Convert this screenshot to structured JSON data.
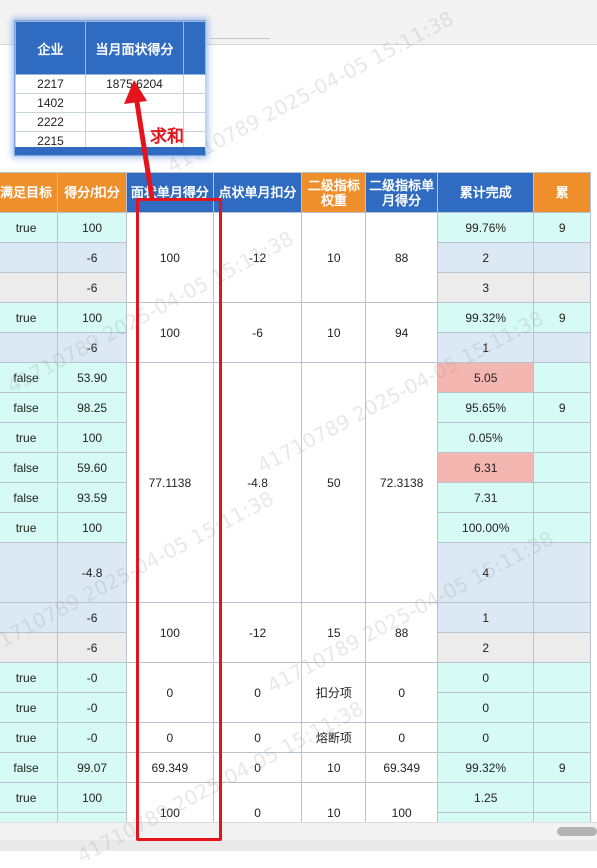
{
  "inset": {
    "headers": [
      "企业",
      "当月面状得分",
      ""
    ],
    "rows": [
      [
        "2217",
        "1875.6204",
        ""
      ],
      [
        "1402",
        "",
        ""
      ],
      [
        "2222",
        "",
        ""
      ],
      [
        "2215",
        "",
        ""
      ]
    ]
  },
  "annotation": {
    "label": "求和",
    "color": "#e5141c"
  },
  "watermark": "41710789 2025-04-05 15:11:38",
  "table": {
    "headers": {
      "c0": "满足目标",
      "c1": "得分/扣分",
      "c2": "面状单月得分",
      "c3": "点状单月扣分",
      "c4": "二级指标权重",
      "c5": "二级指标单月得分",
      "c6": "累计完成",
      "c7": "累"
    },
    "c0": [
      "true",
      "",
      "",
      "true",
      "",
      "false",
      "false",
      "true",
      "false",
      "false",
      "true",
      "",
      "",
      "",
      "true",
      "true",
      "true",
      "false",
      "true"
    ],
    "c1": [
      "100",
      "-6",
      "-6",
      "100",
      "-6",
      "53.90",
      "98.25",
      "100",
      "59.60",
      "93.59",
      "100",
      "-4.8",
      "-6",
      "-6",
      "-0",
      "-0",
      "-0",
      "99.07",
      "100"
    ],
    "c6": [
      "99.76%",
      "2",
      "3",
      "99.32%",
      "1",
      "5.05",
      "95.65%",
      "0.05%",
      "6.31",
      "7.31",
      "100.00%",
      "4",
      "1",
      "2",
      "0",
      "0",
      "0",
      "99.32%",
      "1.25"
    ],
    "c7": [
      "9",
      "",
      "",
      "9",
      "",
      "",
      "9",
      "",
      "",
      "",
      "",
      "",
      "",
      "",
      "",
      "",
      "",
      "9",
      ""
    ],
    "groups": [
      {
        "c2": "100",
        "c3": "-12",
        "c4": "10",
        "c5": "88"
      },
      {
        "c2": "100",
        "c3": "-6",
        "c4": "10",
        "c5": "94"
      },
      {
        "c2": "77.1138",
        "c3": "-4.8",
        "c4": "50",
        "c5": "72.3138"
      },
      {
        "c2": "100",
        "c3": "-12",
        "c4": "15",
        "c5": "88"
      },
      {
        "c2": "0",
        "c3": "0",
        "c4": "扣分项",
        "c5": "0"
      },
      {
        "c2": "0",
        "c3": "0",
        "c4": "熔断项",
        "c5": "0"
      },
      {
        "c2": "69.349",
        "c3": "0",
        "c4": "10",
        "c5": "69.349"
      },
      {
        "c2": "100",
        "c3": "0",
        "c4": "10",
        "c5": "100"
      }
    ]
  },
  "colors": {
    "orange": "#ee8f2c",
    "blue": "#2f6bc0",
    "mint": "#d6fbf4",
    "light_blue": "#dce8f4",
    "gray": "#ececec",
    "pink": "#f4b6b0"
  }
}
